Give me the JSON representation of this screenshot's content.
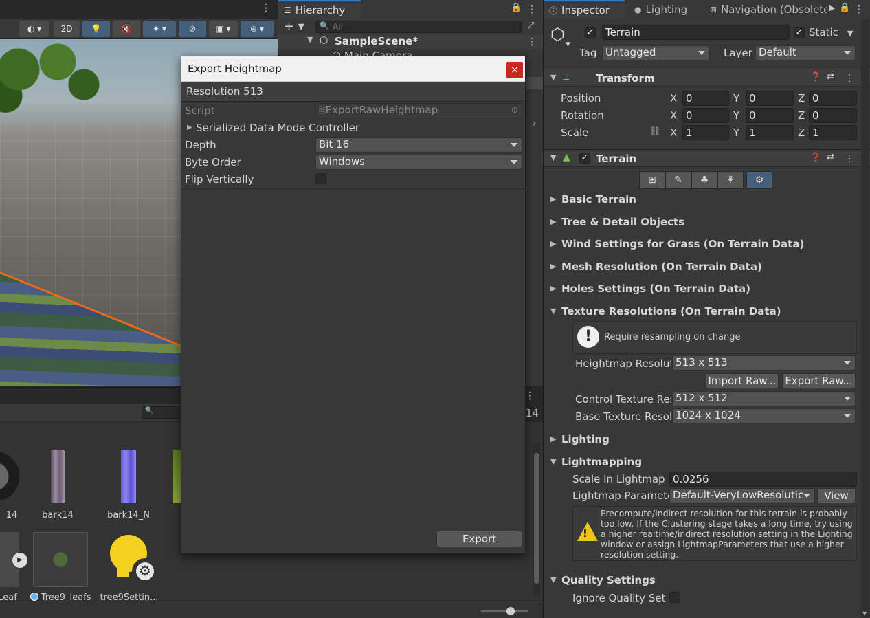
{
  "scene": {
    "toolbar": {
      "mode_2d": "2D"
    }
  },
  "hierarchy": {
    "tab": "Hierarchy",
    "search_placeholder": "All",
    "scene_name": "SampleScene*",
    "items": [
      "Main Camera"
    ]
  },
  "project": {
    "count_label": "14",
    "assets": [
      {
        "label": "14"
      },
      {
        "label": "bark14"
      },
      {
        "label": "bark14_N"
      },
      {
        "label": "Leaf"
      },
      {
        "label": "Tree9_leafs"
      },
      {
        "label": "tree9Settin..."
      }
    ]
  },
  "dialog": {
    "title": "Export Heightmap",
    "close_label": "×",
    "header": "Resolution 513",
    "script_label": "Script",
    "script_value": "ExportRawHeightmap",
    "serialized_label": "Serialized Data Mode Controller",
    "depth_label": "Depth",
    "depth_value": "Bit 16",
    "byte_order_label": "Byte Order",
    "byte_order_value": "Windows",
    "flip_label": "Flip Vertically",
    "flip_checked": false,
    "export_label": "Export"
  },
  "inspector": {
    "tabs": [
      "Inspector",
      "Lighting",
      "Navigation (Obsolete"
    ],
    "object_name": "Terrain",
    "active": true,
    "static_label": "Static",
    "static_checked": true,
    "tag_label": "Tag",
    "tag_value": "Untagged",
    "layer_label": "Layer",
    "layer_value": "Default",
    "transform": {
      "title": "Transform",
      "position_label": "Position",
      "rotation_label": "Rotation",
      "scale_label": "Scale",
      "axis_x": "X",
      "axis_y": "Y",
      "axis_z": "Z",
      "position": [
        "0",
        "0",
        "0"
      ],
      "rotation": [
        "0",
        "0",
        "0"
      ],
      "scale": [
        "1",
        "1",
        "1"
      ]
    },
    "terrain": {
      "title": "Terrain",
      "enabled": true,
      "sections_collapsed": [
        "Basic Terrain",
        "Tree & Detail Objects",
        "Wind Settings for Grass (On Terrain Data)",
        "Mesh Resolution (On Terrain Data)",
        "Holes Settings (On Terrain Data)"
      ],
      "texture_res_title": "Texture Resolutions (On Terrain Data)",
      "resample_note": "Require resampling on change",
      "heightmap_label": "Heightmap Resoluti",
      "heightmap_value": "513 x 513",
      "import_raw": "Import Raw...",
      "export_raw": "Export Raw...",
      "control_label": "Control Texture Res",
      "control_value": "512 x 512",
      "base_label": "Base Texture Resol",
      "base_value": "1024 x 1024",
      "lighting_title": "Lighting",
      "lightmapping_title": "Lightmapping",
      "scale_lightmap_label": "Scale In Lightmap",
      "scale_lightmap_value": "0.0256",
      "lightmap_params_label": "Lightmap Paramete",
      "lightmap_params_value": "Default-VeryLowResolutic",
      "view_label": "View",
      "warning_text": "Precompute/indirect resolution for this terrain is probably too low. If the Clustering stage takes a long time, try using a higher realtime/indirect resolution setting in the Lighting window or assign LightmapParameters that use a higher resolution setting.",
      "quality_title": "Quality Settings",
      "ignore_quality_label": "Ignore Quality Setti"
    }
  },
  "colors": {
    "accent": "#3a79bb",
    "selection_orange": "#f06a1a",
    "close_red": "#c42b1c"
  }
}
